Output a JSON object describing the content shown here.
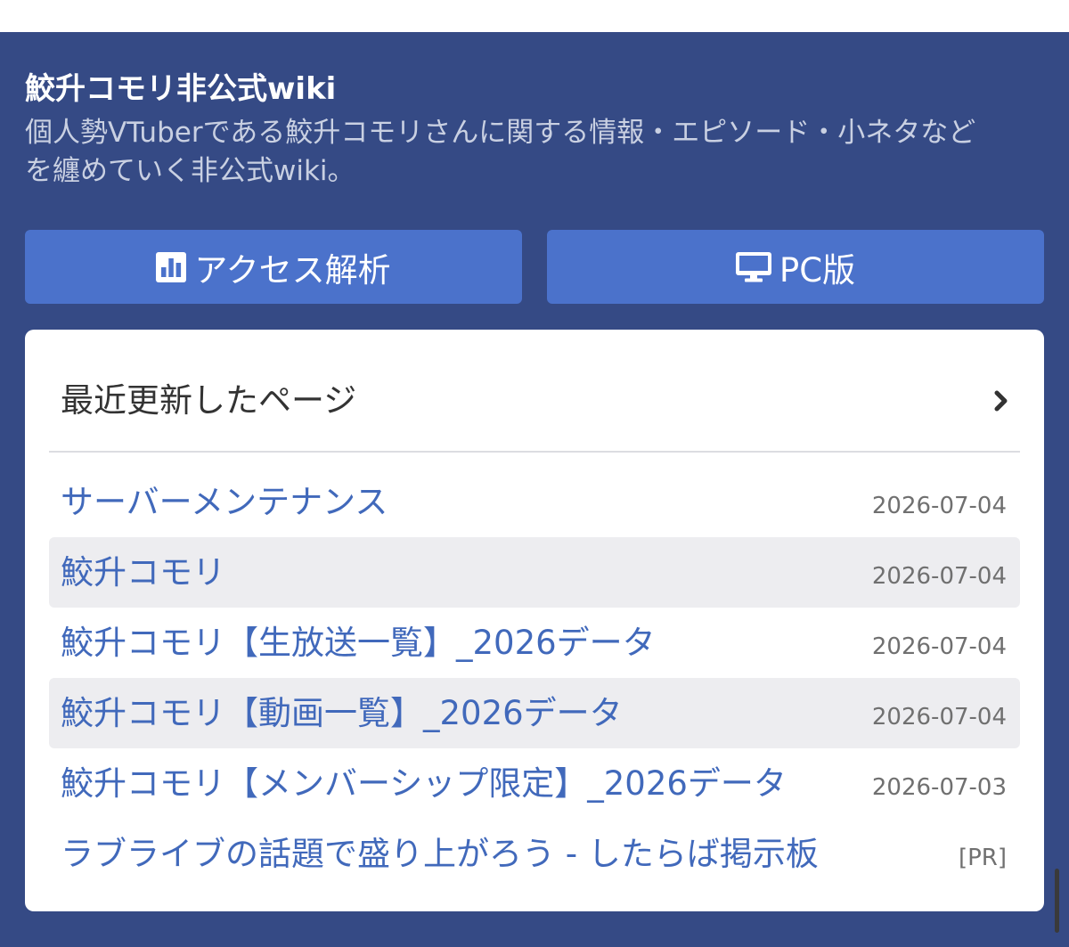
{
  "site": {
    "title": "鮫升コモリ非公式wiki",
    "description_lines": [
      "個人勢VTuberである鮫升コモリさんに関する情報・エピソード・小ネタなど",
      "を纏めていく非公式wiki。"
    ]
  },
  "buttons": [
    {
      "label": "アクセス解析",
      "icon": "bar-chart-icon"
    },
    {
      "label": "PC版",
      "icon": "desktop-monitor-icon"
    }
  ],
  "recent_pages": {
    "heading": "最近更新したページ",
    "more_icon": "chevron-right-icon",
    "items": [
      {
        "title": "サーバーメンテナンス",
        "date": "2026-07-04"
      },
      {
        "title": "鮫升コモリ",
        "date": "2026-07-04"
      },
      {
        "title": "鮫升コモリ【生放送一覧】_2026データ",
        "date": "2026-07-04"
      },
      {
        "title": "鮫升コモリ【動画一覧】_2026データ",
        "date": "2026-07-04"
      },
      {
        "title": "鮫升コモリ【メンバーシップ限定】_2026データ",
        "date": "2026-07-03"
      }
    ],
    "ad": {
      "title": "ラブライブの話題で盛り上がろう - したらば掲示板",
      "tag": "[PR]"
    }
  },
  "colors": {
    "header_background": "#354a85",
    "button": "#4b72cb",
    "link": "#4169bb",
    "stripe": "#ededf0",
    "date_text": "#707070"
  }
}
